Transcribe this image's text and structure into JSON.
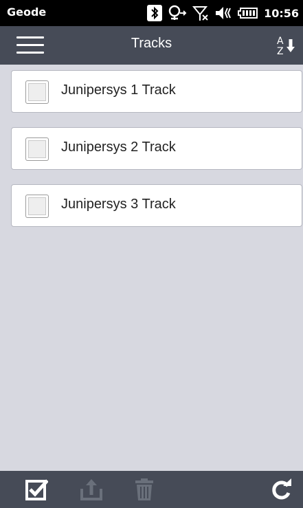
{
  "status": {
    "app_name": "Geode",
    "time": "10:56",
    "icons": [
      "bluetooth-icon",
      "gps-icon",
      "no-signal-icon",
      "volume-icon",
      "battery-icon"
    ]
  },
  "header": {
    "title": "Tracks",
    "menu_icon": "hamburger-menu-icon",
    "sort_icon": "sort-a-z-icon"
  },
  "tracks": [
    {
      "label": "Junipersys 1 Track",
      "checked": false
    },
    {
      "label": "Junipersys 2 Track",
      "checked": false
    },
    {
      "label": "Junipersys 3 Track",
      "checked": false
    }
  ],
  "toolbar": {
    "icons": [
      "select-all-icon",
      "export-icon",
      "delete-icon",
      "refresh-icon"
    ],
    "colors": {
      "active": "#ffffff",
      "disabled": "#6a707b"
    }
  },
  "colors": {
    "background": "#d7d8e0",
    "bar": "#464b57",
    "statusbar": "#000000"
  }
}
